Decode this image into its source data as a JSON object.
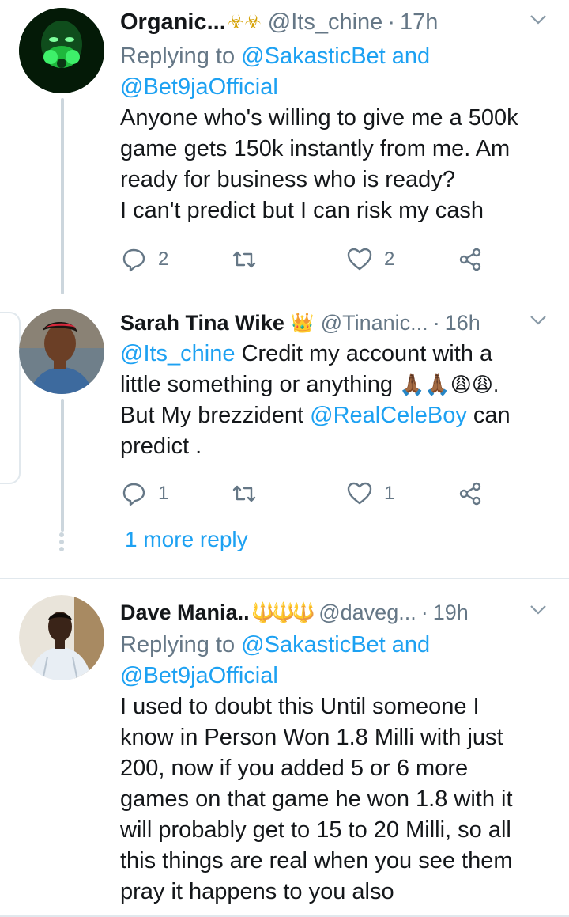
{
  "tweets": [
    {
      "name": "Organic...",
      "name_emoji": "☣☣",
      "handle": "@Its_chine",
      "time": "17h",
      "replying_prefix": "Replying to ",
      "replying_user1": "@SakasticBet",
      "replying_and": " and",
      "replying_user2": "@Bet9jaOfficial",
      "lines": [
        "Anyone who's willing to give me a 500k",
        "game gets 150k instantly from me. Am",
        "ready for business who is ready?",
        "I can't predict but I can risk my cash"
      ],
      "reply_count": "2",
      "retweet_count": "",
      "like_count": "2"
    },
    {
      "name": "Sarah Tina Wike",
      "name_emoji": "👑",
      "handle": "@Tinanic...",
      "time": "16h",
      "mention": "@Its_chine",
      "line1_rest": " Credit my account with a",
      "line2": "little something or anything ",
      "line2_emoji": "🙏🏾🙏🏾😩😩.",
      "line3_prefix": "But My brezzident ",
      "line3_mention": "@RealCeleBoy",
      "line3_rest": " can",
      "line4": "predict .",
      "reply_count": "1",
      "retweet_count": "",
      "like_count": "1"
    },
    {
      "name": "Dave Mania..",
      "name_emoji": "🔱🔱🔱",
      "handle": "@daveg...",
      "time": "19h",
      "replying_prefix": "Replying to ",
      "replying_user1": "@SakasticBet",
      "replying_and": " and",
      "replying_user2": "@Bet9jaOfficial",
      "lines": [
        "I used to doubt this Until someone I",
        "know in Person Won 1.8 Milli with just",
        "200, now if you added 5 or 6 more",
        "games on that game he won 1.8 with it",
        "will probably get to 15 to 20 Milli,  so all",
        "this things are real when you see them",
        "pray it happens to you also"
      ]
    }
  ],
  "more_reply_label": "1 more reply",
  "icons": {
    "reply": "reply-icon",
    "retweet": "retweet-icon",
    "like": "heart-icon",
    "share": "share-icon",
    "menu": "chevron-down-icon"
  },
  "colors": {
    "link": "#1da1f2",
    "muted": "#657786",
    "text": "#14171a",
    "divider": "#e1e8ed"
  }
}
